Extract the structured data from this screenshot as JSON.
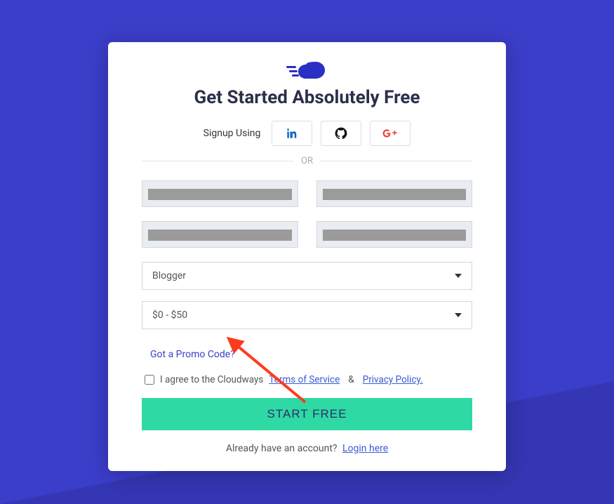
{
  "title": "Get Started Absolutely Free",
  "social": {
    "label": "Signup Using"
  },
  "divider": "OR",
  "selects": {
    "role": "Blogger",
    "budget": "$0 - $50"
  },
  "promo": "Got a Promo Code?",
  "agree": {
    "prefix": "I agree to the Cloudways",
    "tos": "Terms of Service",
    "amp": "&",
    "privacy": "Privacy Policy."
  },
  "cta": "START FREE",
  "login": {
    "prefix": "Already have an account?",
    "link": "Login here"
  }
}
